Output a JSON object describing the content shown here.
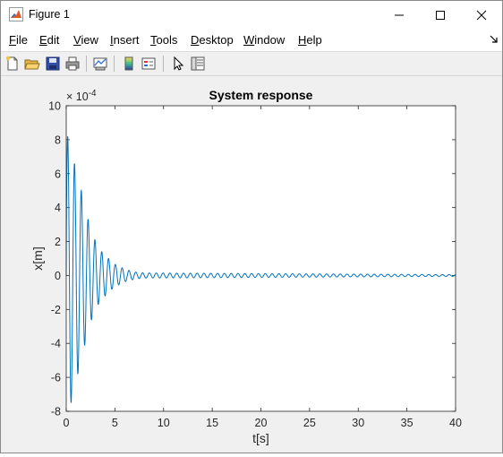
{
  "window": {
    "title": "Figure 1"
  },
  "menu": [
    {
      "name": "menu-file",
      "ul": "F",
      "rest": "ile"
    },
    {
      "name": "menu-edit",
      "ul": "E",
      "rest": "dit"
    },
    {
      "name": "menu-view",
      "ul": "V",
      "rest": "iew"
    },
    {
      "name": "menu-insert",
      "ul": "I",
      "rest": "nsert"
    },
    {
      "name": "menu-tools",
      "ul": "T",
      "rest": "ools"
    },
    {
      "name": "menu-desktop",
      "ul": "D",
      "rest": "esktop"
    },
    {
      "name": "menu-window",
      "ul": "W",
      "rest": "indow"
    },
    {
      "name": "menu-help",
      "ul": "H",
      "rest": "elp"
    }
  ],
  "toolbar": [
    "new-figure-icon",
    "open-file-icon",
    "save-icon",
    "print-icon",
    "link-plot-icon",
    "colorbar-icon",
    "legend-icon",
    "pointer-icon",
    "property-inspector-icon"
  ],
  "colors": {
    "line": "#0072BD",
    "axes_bg": "#ffffff",
    "figure_bg": "#f0f0f0"
  },
  "chart_data": {
    "type": "line",
    "title": "System response",
    "xlabel": "t[s]",
    "ylabel": "x[m]",
    "exponent_label": "× 10",
    "exponent": "-4",
    "xlim": [
      0,
      40
    ],
    "ylim": [
      -8,
      10
    ],
    "xticks": [
      0,
      5,
      10,
      15,
      20,
      25,
      30,
      35,
      40
    ],
    "yticks": [
      -8,
      -6,
      -4,
      -2,
      0,
      2,
      4,
      6,
      8,
      10
    ],
    "series": [
      {
        "description": "decaying oscillation (peak amplitudes in 1e-4 m)",
        "peaks": [
          {
            "t": 0.15,
            "x": 8.2
          },
          {
            "t": 0.5,
            "x": -7.5
          },
          {
            "t": 0.85,
            "x": 6.6
          },
          {
            "t": 1.2,
            "x": -5.8
          },
          {
            "t": 1.55,
            "x": 5.0
          },
          {
            "t": 1.9,
            "x": -4.1
          },
          {
            "t": 2.25,
            "x": 3.3
          },
          {
            "t": 2.6,
            "x": -2.6
          },
          {
            "t": 2.95,
            "x": 2.1
          },
          {
            "t": 3.3,
            "x": -1.7
          },
          {
            "t": 3.65,
            "x": 1.4
          },
          {
            "t": 4.0,
            "x": -1.2
          },
          {
            "t": 4.35,
            "x": 1.0
          },
          {
            "t": 4.7,
            "x": -0.8
          },
          {
            "t": 5.05,
            "x": 0.65
          },
          {
            "t": 5.4,
            "x": -0.55
          },
          {
            "t": 5.75,
            "x": 0.45
          },
          {
            "t": 6.1,
            "x": -0.35
          },
          {
            "t": 6.45,
            "x": 0.3
          },
          {
            "t": 6.8,
            "x": -0.25
          },
          {
            "t": 7.15,
            "x": 0.2
          },
          {
            "t": 8.0,
            "x": 0.15
          },
          {
            "t": 40.0,
            "x": 0.05
          }
        ],
        "settled_amplitude": 0.05,
        "period": 0.7
      }
    ]
  }
}
